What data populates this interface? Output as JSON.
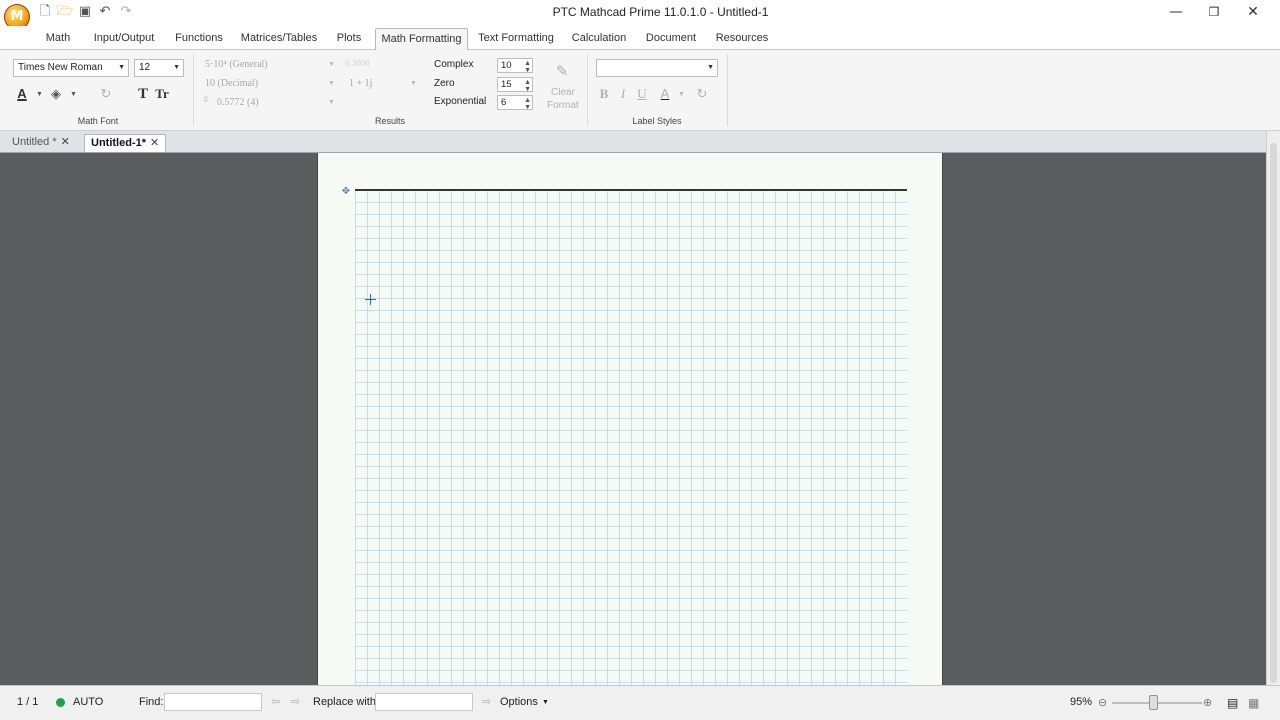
{
  "titlebar": {
    "app_logo_letter": "M",
    "title": "PTC Mathcad Prime 11.0.1.0 - Untitled-1",
    "quick_access": [
      "new-document-icon",
      "open-folder-icon",
      "save-icon",
      "undo-icon",
      "redo-icon"
    ],
    "window_controls": {
      "minimize": "—",
      "restore": "❐",
      "close": "✕"
    }
  },
  "ribbon_tabs": [
    {
      "label": "Math"
    },
    {
      "label": "Input/Output"
    },
    {
      "label": "Functions"
    },
    {
      "label": "Matrices/Tables"
    },
    {
      "label": "Plots"
    },
    {
      "label": "Math Formatting",
      "active": true
    },
    {
      "label": "Text Formatting"
    },
    {
      "label": "Calculation"
    },
    {
      "label": "Document"
    },
    {
      "label": "Resources"
    }
  ],
  "ribbon": {
    "math_font": {
      "font_value": "Times New Roman",
      "size_value": "12",
      "group_label": "Math Font"
    },
    "results": {
      "general_format": "5·10⁴ (General)",
      "general_value": "0.3000",
      "decimal_format": "10 (Decimal)",
      "complex_format": "1 + 1j",
      "precision_format": "0.5772 (4)",
      "group_label": "Results",
      "complex_label": "Complex",
      "complex_value": "10",
      "zero_label": "Zero",
      "zero_value": "15",
      "exponential_label": "Exponential",
      "exponential_value": "6",
      "clear_format_label_1": "Clear",
      "clear_format_label_2": "Format"
    },
    "label_styles": {
      "value": "",
      "group_label": "Label Styles",
      "bold": "B",
      "italic": "I",
      "underline": "U",
      "font_color": "A"
    }
  },
  "document_tabs": [
    {
      "label": "Untitled *",
      "active": false
    },
    {
      "label": "Untitled-1*",
      "active": true
    }
  ],
  "statusbar": {
    "page_indicator": "1 / 1",
    "calc_mode": "AUTO",
    "find_label": "Find:",
    "find_value": "",
    "replace_label": "Replace with:",
    "replace_value": "",
    "options_label": "Options",
    "zoom": "95%"
  },
  "colors": {
    "workspace": "#5b5d5f",
    "page": "#f5faf5",
    "auto_indicator": "#1aa34a"
  }
}
